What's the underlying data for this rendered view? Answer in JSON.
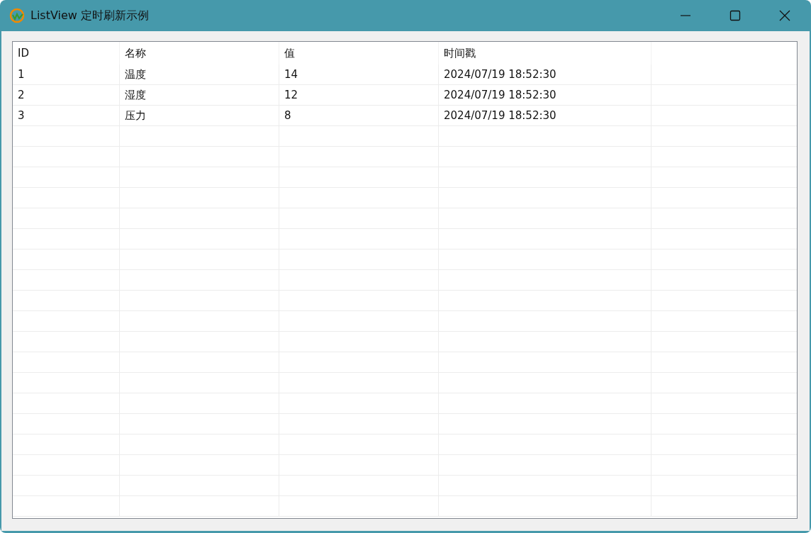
{
  "window": {
    "title": "ListView 定时刷新示例"
  },
  "table": {
    "columns": [
      "ID",
      "名称",
      "值",
      "时间戳"
    ],
    "rows": [
      [
        "1",
        "温度",
        "14",
        "2024/07/19 18:52:30"
      ],
      [
        "2",
        "湿度",
        "12",
        "2024/07/19 18:52:30"
      ],
      [
        "3",
        "压力",
        "8",
        "2024/07/19 18:52:30"
      ]
    ]
  }
}
